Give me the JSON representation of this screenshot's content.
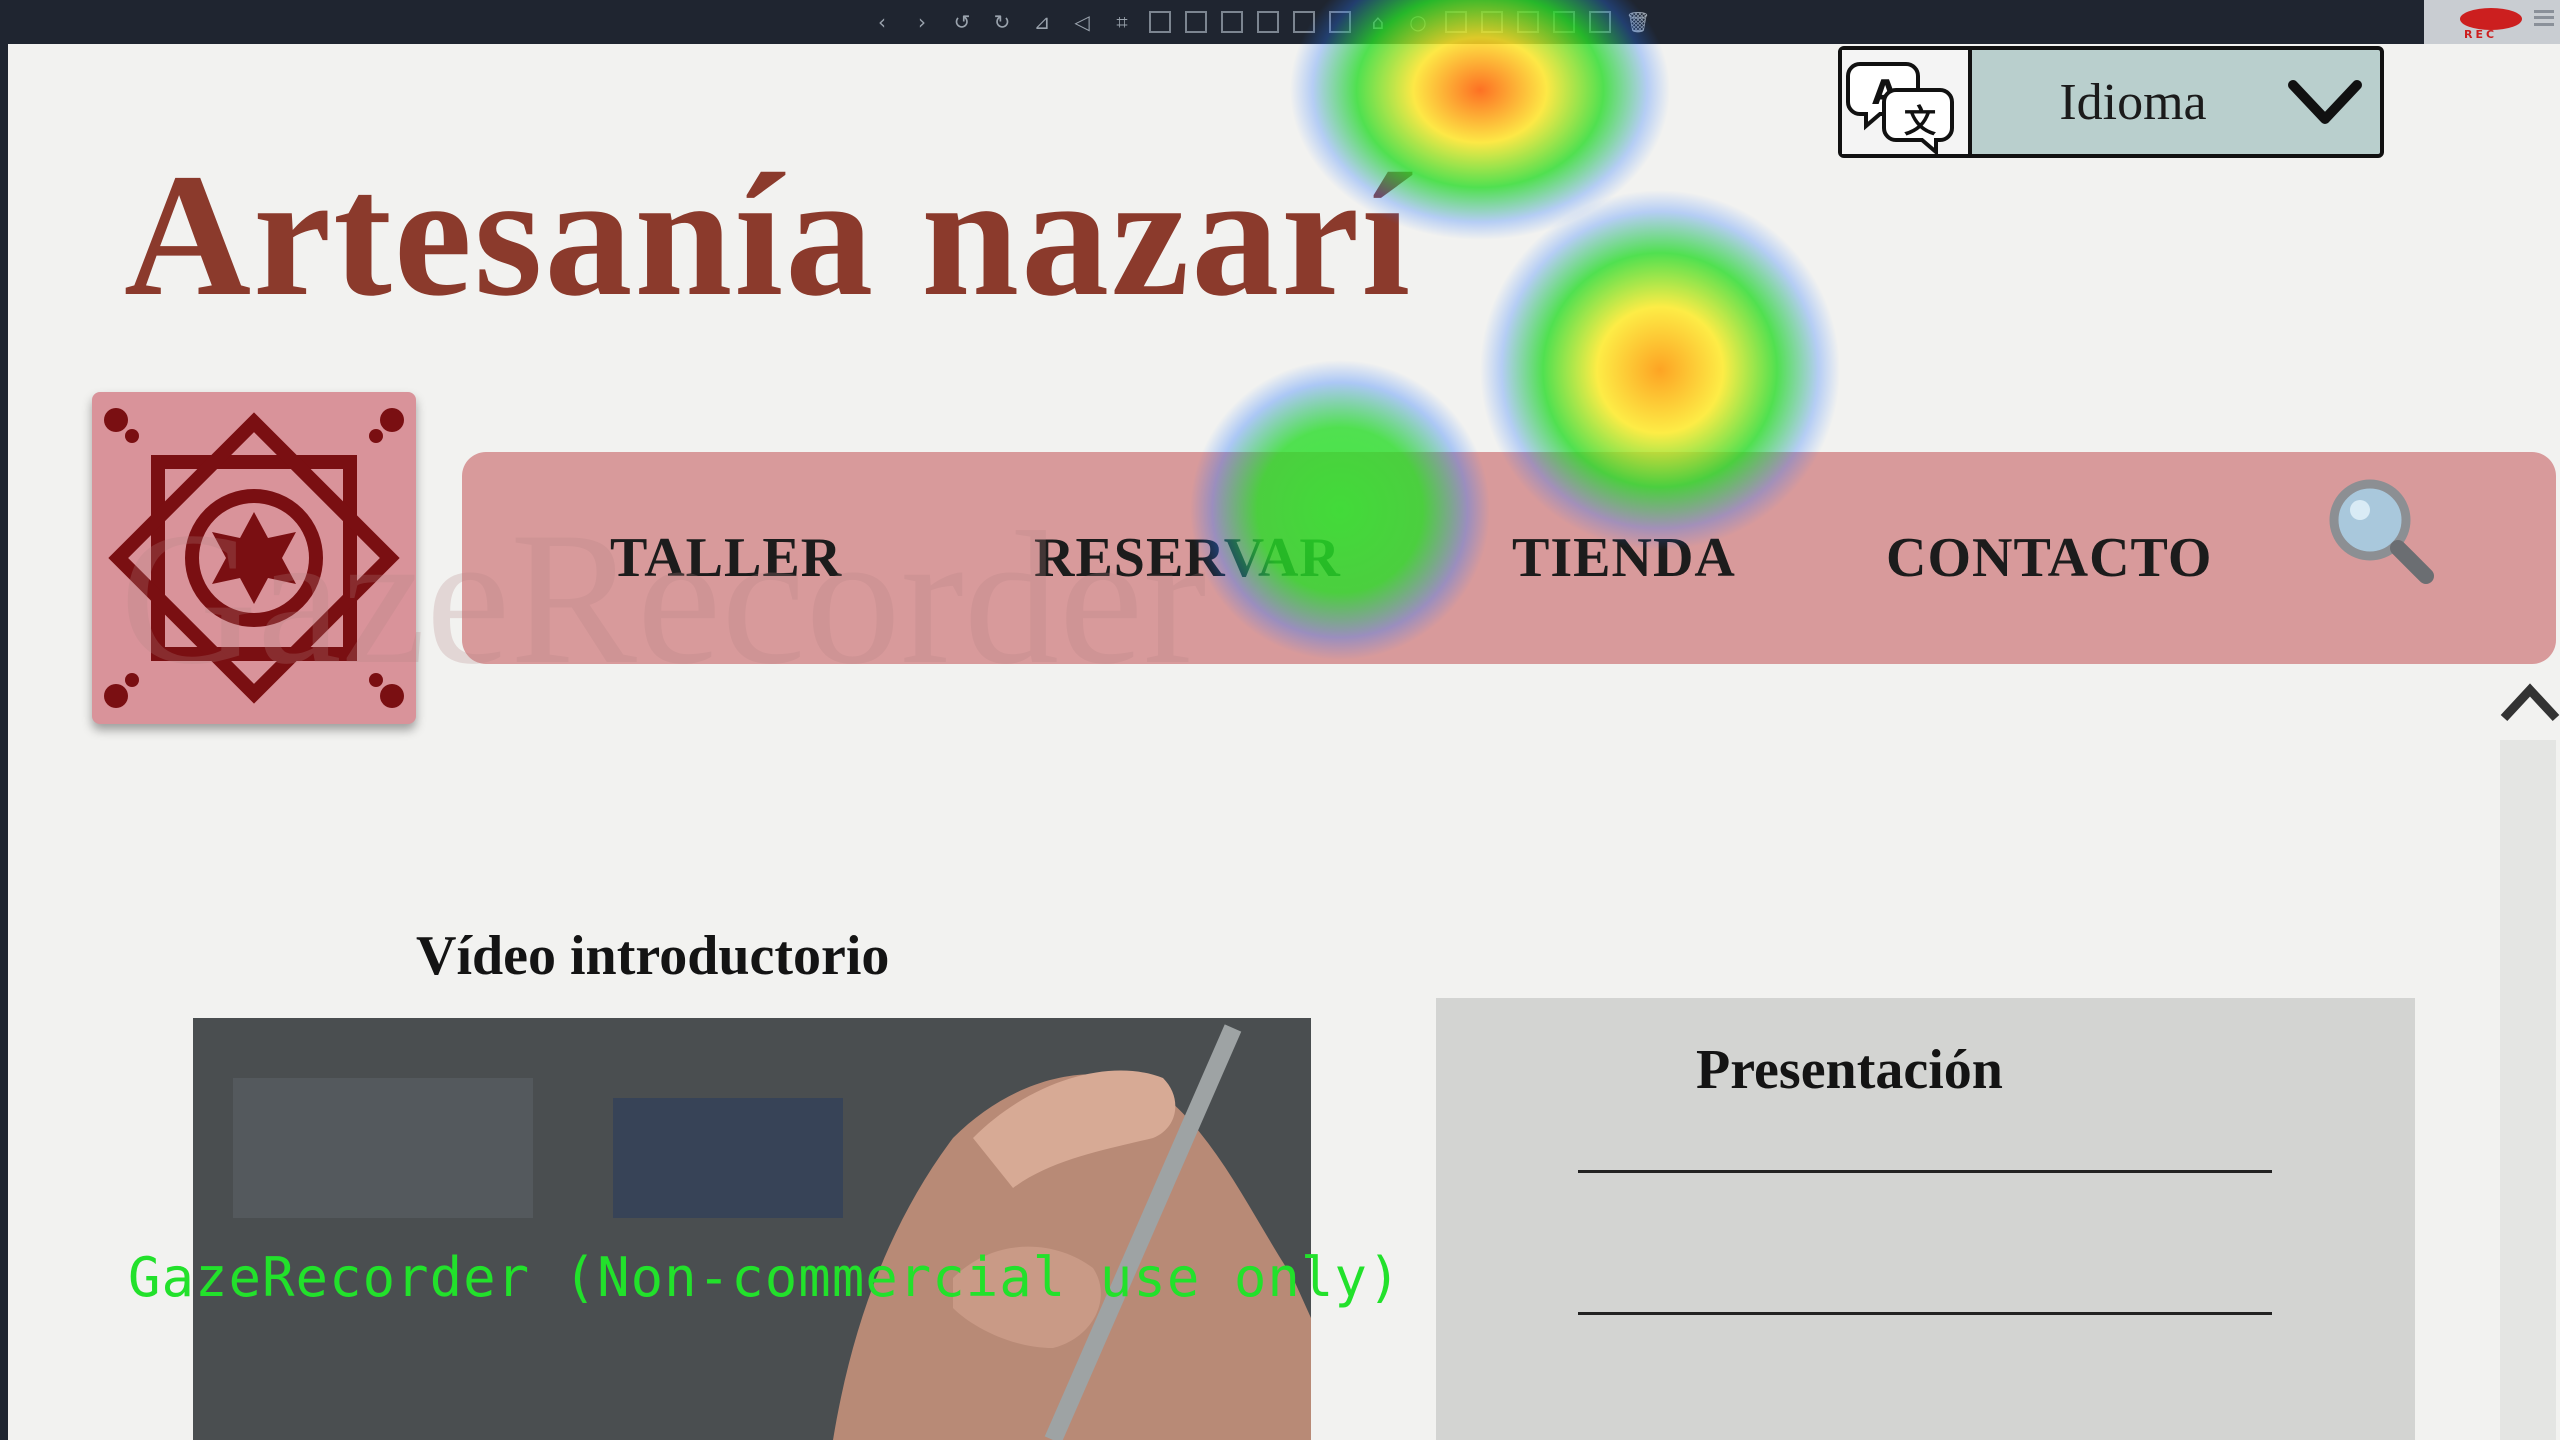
{
  "toolbar": {
    "tools": [
      "back-icon",
      "forward-icon",
      "undo-icon",
      "redo-icon",
      "flip-icon",
      "rotate-icon",
      "crop-icon",
      "tool-a-icon",
      "tool-b-icon",
      "tool-c-icon",
      "tool-d-icon",
      "tool-e-icon",
      "tool-f-icon",
      "tool-g-icon",
      "tool-h-icon",
      "tool-i-icon",
      "tool-j-icon",
      "tool-k-icon",
      "tool-l-icon",
      "tool-m-icon",
      "delete-icon"
    ],
    "rec_label": "REC"
  },
  "language": {
    "label": "Idioma",
    "icon": "translate-icon",
    "chevron": "chevron-down-icon"
  },
  "site": {
    "title": "Artesanía nazarí"
  },
  "nav": {
    "items": [
      "TALLER",
      "RESERVAR",
      "TIENDA",
      "CONTACTO"
    ],
    "search_icon": "search-icon"
  },
  "watermark": "GazeRecorder",
  "video": {
    "title": "Vídeo introductorio"
  },
  "presentation": {
    "title": "Presentación"
  },
  "overlay": {
    "note": "GazeRecorder (Non-commercial use only)"
  },
  "colors": {
    "title": "#8b3a2c",
    "nav_bg": "#d89a9b",
    "logo_bg": "#d9939a",
    "logo_pattern": "#7a0f12",
    "lang_bg": "#b9cfcd",
    "panel_bg": "#d3d4d2",
    "overlay_text": "#22e12b"
  }
}
